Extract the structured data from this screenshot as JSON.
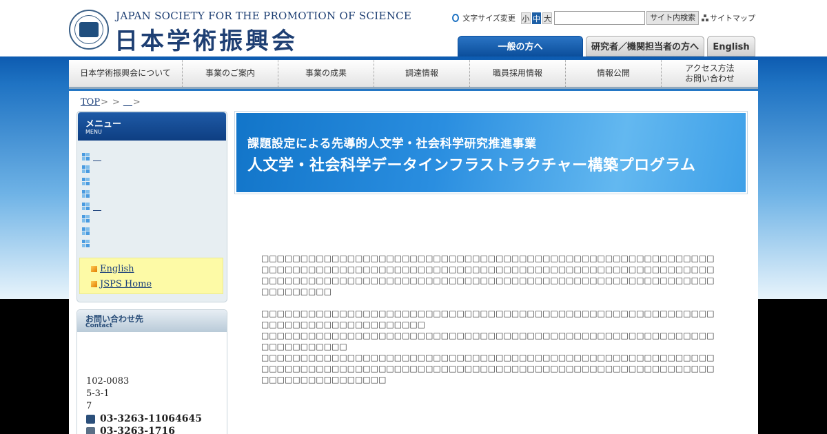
{
  "header": {
    "logo_en": "JAPAN SOCIETY FOR THE PROMOTION OF SCIENCE",
    "logo_jp": "日本学術振興会",
    "font_size_label": "文字サイズ変更",
    "font_sizes": [
      "小",
      "中",
      "大"
    ],
    "search_value": "",
    "search_button": "サイト内検索",
    "sitemap_label": "サイトマップ"
  },
  "tabs": {
    "general": "一般の方へ",
    "researcher": "研究者／機関担当者の方へ",
    "english": "English"
  },
  "gnav": [
    "日本学術振興会について",
    "事業のご案内",
    "事業の成果",
    "調達情報",
    "職員採用情報",
    "情報公開",
    "アクセス方法\nお問い合わせ"
  ],
  "breadcrumb": {
    "top": "TOP",
    "sep": ">",
    "current": "＿"
  },
  "side_menu": {
    "title": "メニュー",
    "subtitle": "MENU",
    "items": [
      "＿",
      "",
      "",
      "",
      "＿",
      "",
      "",
      ""
    ]
  },
  "side_links": [
    "English",
    "JSPS Home"
  ],
  "contact": {
    "title": "お問い合わせ先",
    "subtitle": "Contact",
    "postal": "102-0083",
    "address1": "5-3-1",
    "address2": "7",
    "phone": "03-3263-11064645",
    "fax": "03-3263-1716"
  },
  "banner": {
    "line1": "課題設定による先導的人文学・社会科学研究推進事業",
    "line2": "人文学・社会科学データインフラストラクチャー構築プログラム"
  },
  "body": {
    "p1": "□□□□□□□□□□□□□□□□□□□□□□□□□□□□□□□□□□□□□□□□□□□□□□□□□□□□□□□□□□□□□□□□□□□□□□□□□□□□□□□□□□□□□□□□□□□□□□□□□□□□□□□□□□□□□□□□□□□□□□□□□□□□□□□□□□□□□□□□□□□□□□□□□□□□□□□□□□□□□□□□□□□□□□□□□□□□□□□□□□□□□□□",
    "p2": "□□□□□□□□□□□□□□□□□□□□□□□□□□□□□□□□□□□□□□□□□□□□□□□□□□□□□□□□□□□□□□□□□□□□□□□□□□□□□□□",
    "p3": "□□□□□□□□□□□□□□□□□□□□□□□□□□□□□□□□□□□□□□□□□□□□□□□□□□□□□□□□□□□□□□□□□□□□□",
    "p4": "□□□□□□□□□□□□□□□□□□□□□□□□□□□□□□□□□□□□□□□□□□□□□□□□□□□□□□□□□□□□□□□□□□□□□□□□□□□□□□□□□□□□□□□□□□□□□□□□□□□□□□□□□□□□□□□□□□□□□□□□□□□□□□□□□□□□"
  }
}
